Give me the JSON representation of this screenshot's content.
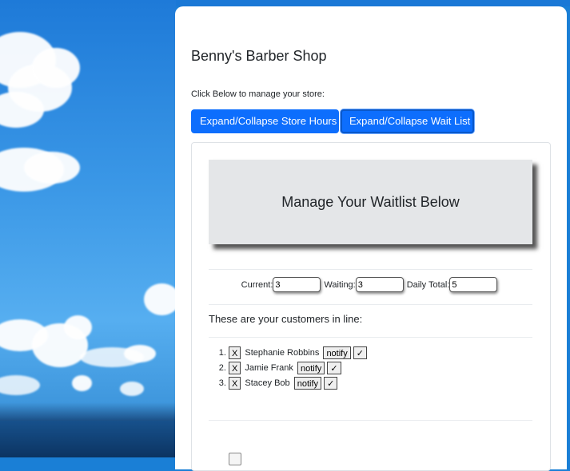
{
  "header": {
    "title": "Benny's Barber Shop",
    "subtitle": "Click Below to manage your store:"
  },
  "buttons": {
    "store_hours": "Expand/Collapse Store Hours",
    "wait_list": "Expand/Collapse Wait List"
  },
  "waitlist": {
    "banner": "Manage Your Waitlist Below",
    "current_label": "Current:",
    "current_value": "3",
    "waiting_label": "Waiting:",
    "waiting_value": "3",
    "daily_label": "Daily Total:",
    "daily_value": "5",
    "customers_heading": "These are your customers in line:",
    "remove_label": "X",
    "notify_label": "notify",
    "check_label": "✓",
    "customers": [
      {
        "name": "Stephanie Robbins"
      },
      {
        "name": "Jamie Frank"
      },
      {
        "name": "Stacey Bob"
      }
    ]
  }
}
